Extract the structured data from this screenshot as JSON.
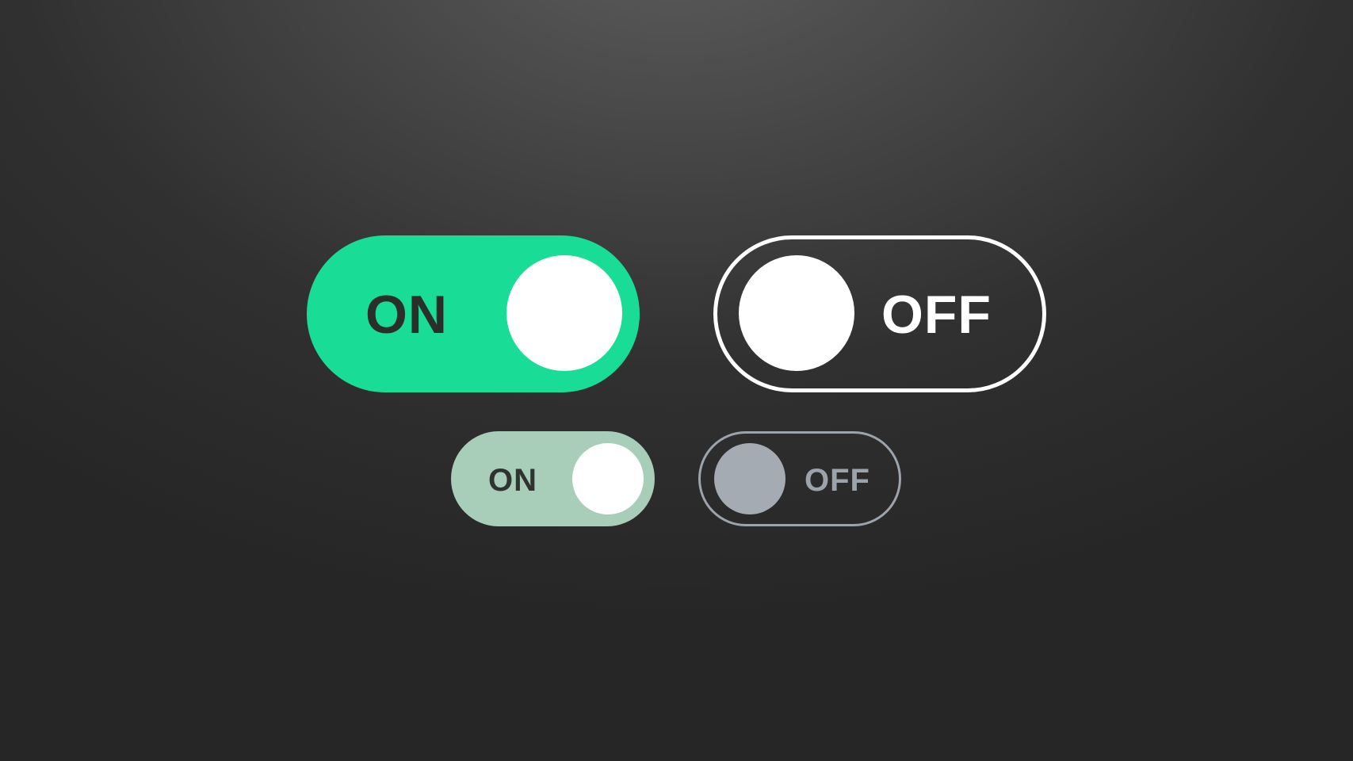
{
  "toggles": {
    "large_on": {
      "label": "ON",
      "state": "on",
      "track_color": "#19dc97",
      "knob_color": "#ffffff",
      "label_color": "#2a2f2c"
    },
    "large_off": {
      "label": "OFF",
      "state": "off",
      "outline_color": "#ffffff",
      "knob_color": "#ffffff",
      "label_color": "#ffffff"
    },
    "small_on": {
      "label": "ON",
      "state": "on",
      "track_color": "#a8cdb9",
      "knob_color": "#ffffff",
      "label_color": "#2f3431"
    },
    "small_off": {
      "label": "OFF",
      "state": "off",
      "outline_color": "#9ca3ab",
      "knob_color": "#a5abb3",
      "label_color": "#9ca3ab"
    }
  },
  "colors": {
    "background_top": "#5e5e5e",
    "background_bottom": "#262626"
  }
}
